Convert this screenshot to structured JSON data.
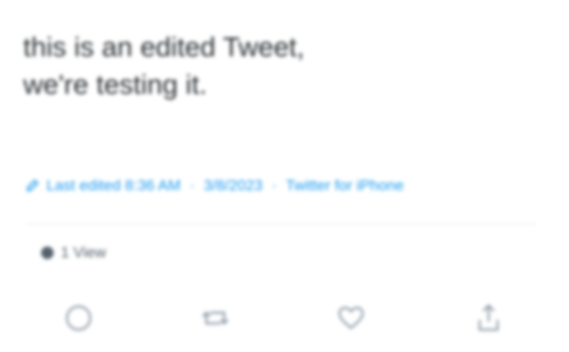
{
  "tweet": {
    "text_line1": "this is an edited Tweet,",
    "text_line2": "we're testing it."
  },
  "meta": {
    "edited_label": "Last edited 8:36 AM",
    "date": "3/8/2023",
    "source": "Twitter for iPhone",
    "separator": "·",
    "accent_color": "#1d9bf0"
  },
  "views": {
    "label": "1 View"
  },
  "actions": [
    {
      "name": "reply",
      "icon": "reply-icon"
    },
    {
      "name": "retweet",
      "icon": "retweet-icon"
    },
    {
      "name": "like",
      "icon": "heart-icon"
    },
    {
      "name": "share",
      "icon": "share-icon"
    }
  ],
  "colors": {
    "text": "#2a2f33",
    "muted": "#54606b",
    "icon": "#8b98a5",
    "divider": "#e4e8ec"
  }
}
